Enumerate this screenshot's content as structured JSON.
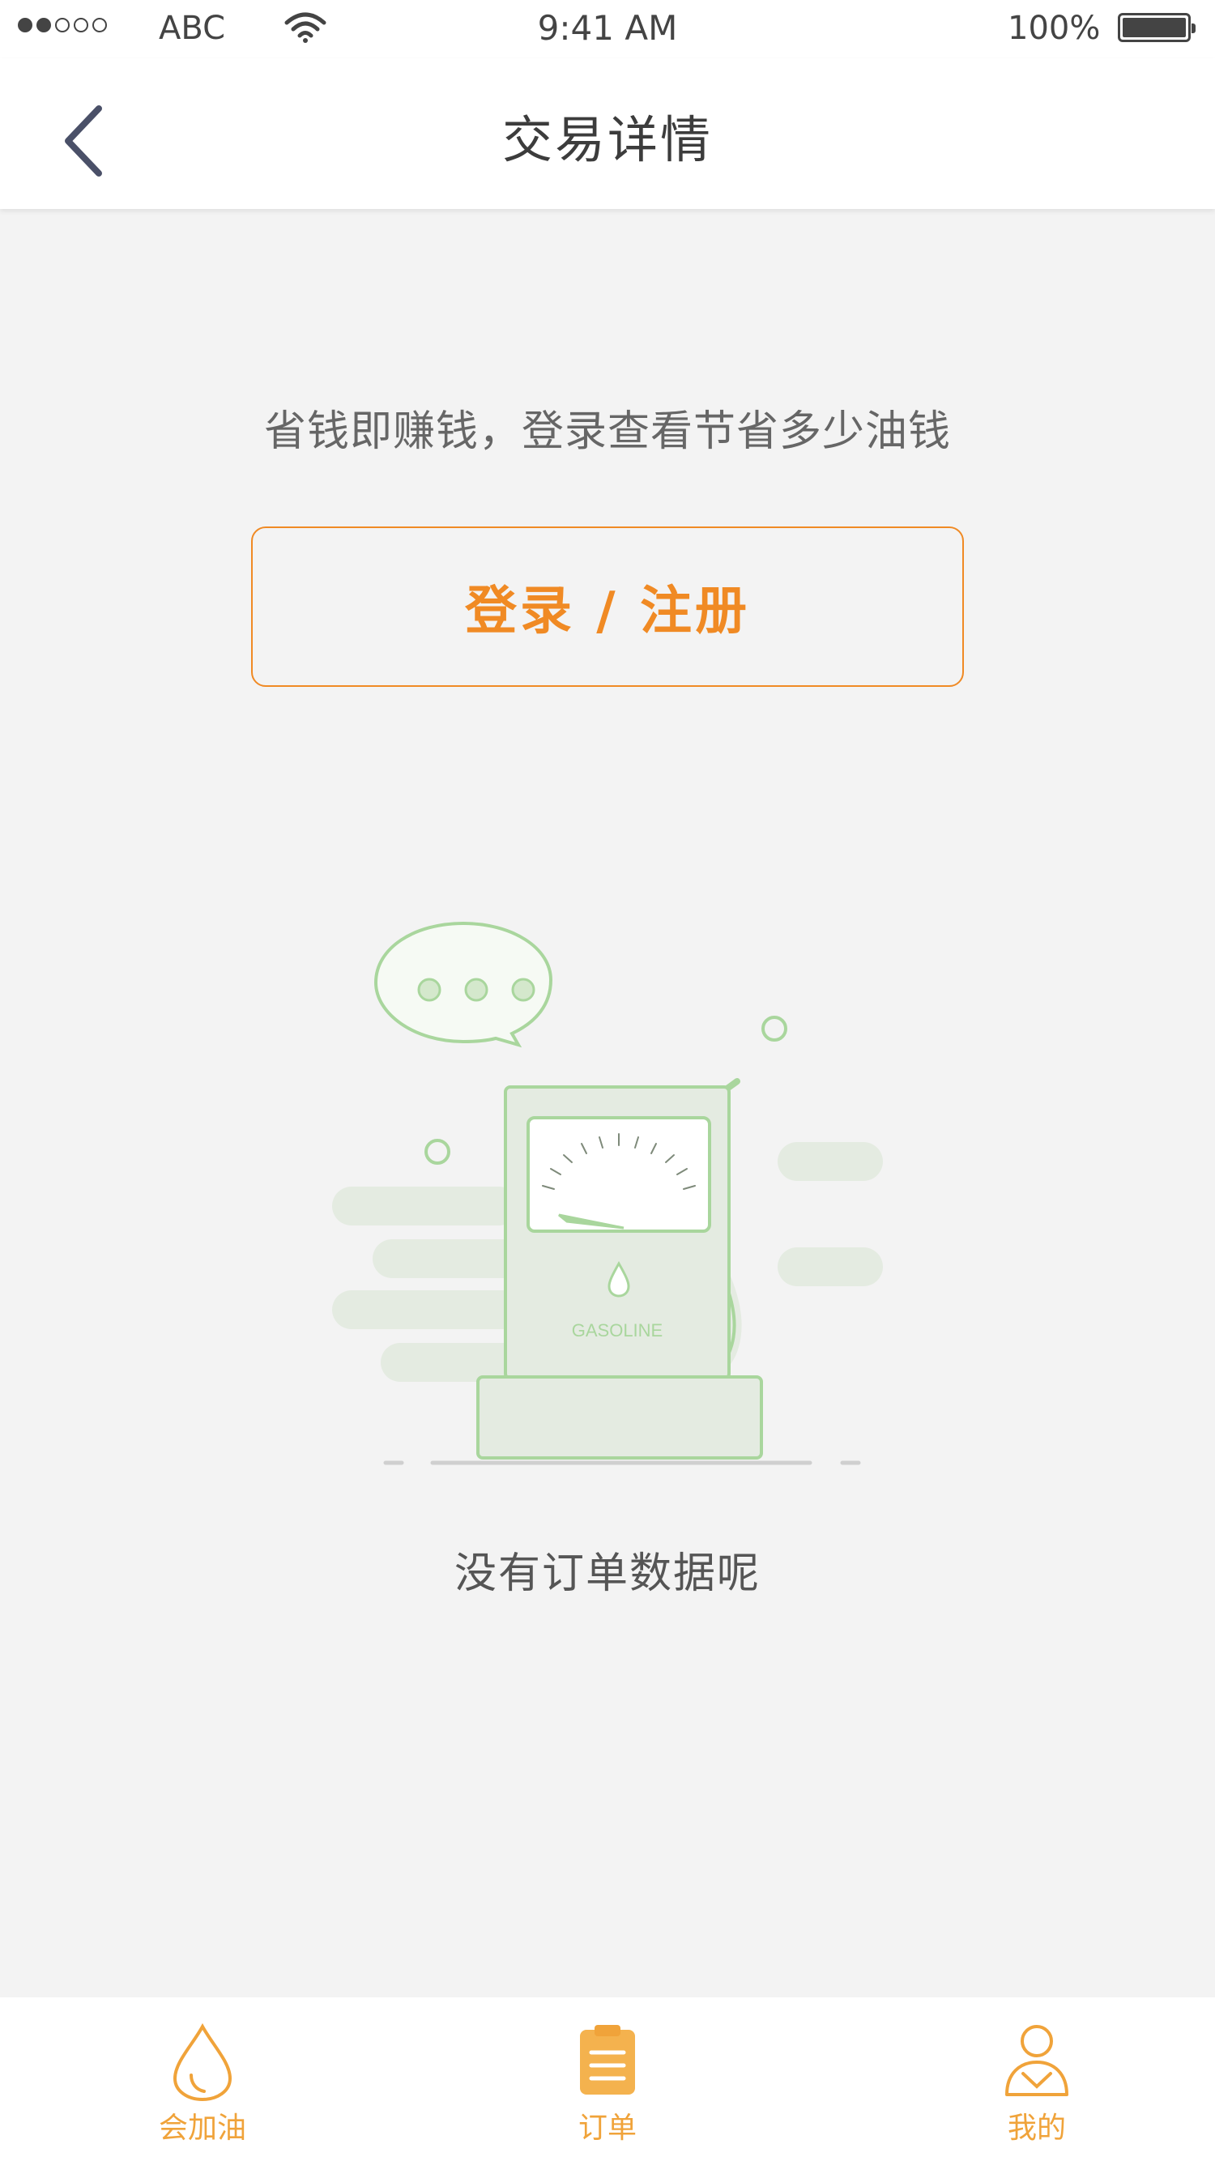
{
  "status_bar": {
    "carrier": "ABC",
    "time": "9:41 AM",
    "battery_percent": "100%",
    "signal_bars": 2,
    "icons": [
      "signal-icon",
      "wifi-icon",
      "battery-icon"
    ]
  },
  "nav": {
    "title": "交易详情",
    "back_icon": "chevron-left-icon"
  },
  "main": {
    "promo_text": "省钱即赚钱，登录查看节省多少油钱",
    "login_button": "登录 / 注册",
    "empty_illustration": {
      "label": "GASOLINE",
      "icon": "gas-pump-illustration"
    },
    "empty_text": "没有订单数据呢"
  },
  "tabbar": {
    "items": [
      {
        "label": "会加油",
        "icon": "oil-drop-icon",
        "active": false
      },
      {
        "label": "订单",
        "icon": "clipboard-icon",
        "active": true
      },
      {
        "label": "我的",
        "icon": "person-icon",
        "active": false
      }
    ]
  },
  "colors": {
    "accent": "#f08a24",
    "tab_accent": "#f0a33a",
    "background": "#f3f3f3",
    "illustration_green": "#a9d69d"
  }
}
